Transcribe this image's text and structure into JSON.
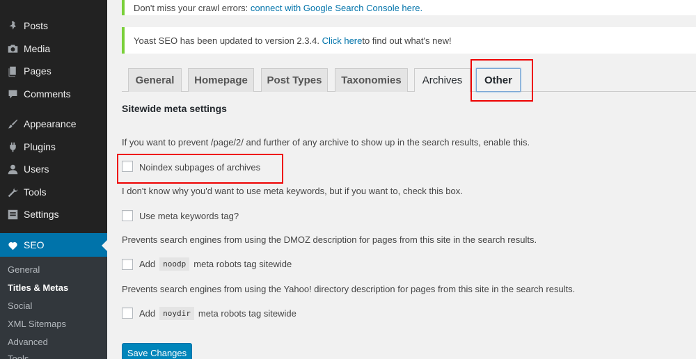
{
  "sidebar": {
    "items": [
      {
        "label": "Posts",
        "icon": "pushpin-icon"
      },
      {
        "label": "Media",
        "icon": "media-icon"
      },
      {
        "label": "Pages",
        "icon": "pages-icon"
      },
      {
        "label": "Comments",
        "icon": "comments-icon"
      },
      {
        "label": "Appearance",
        "icon": "brush-icon"
      },
      {
        "label": "Plugins",
        "icon": "plugin-icon"
      },
      {
        "label": "Users",
        "icon": "users-icon"
      },
      {
        "label": "Tools",
        "icon": "wrench-icon"
      },
      {
        "label": "Settings",
        "icon": "settings-icon"
      }
    ],
    "seo_label": "SEO",
    "submenu": [
      "General",
      "Titles & Metas",
      "Social",
      "XML Sitemaps",
      "Advanced",
      "Tools"
    ]
  },
  "notices": {
    "crawl_text": "Don't miss your crawl errors: ",
    "crawl_link": "connect with Google Search Console here.",
    "update_text": "Yoast SEO has been updated to version 2.3.4. ",
    "update_link": "Click here",
    "update_tail": " to find out what's new!"
  },
  "tabs": [
    "General",
    "Homepage",
    "Post Types",
    "Taxonomies",
    "Archives",
    "Other"
  ],
  "section_title": "Sitewide meta settings",
  "options": {
    "desc1": "If you want to prevent /page/2/ and further of any archive to show up in the search results, enable this.",
    "label1": "Noindex subpages of archives",
    "desc2": "I don't know why you'd want to use meta keywords, but if you want to, check this box.",
    "label2": "Use meta keywords tag?",
    "desc3": "Prevents search engines from using the DMOZ description for pages from this site in the search results.",
    "label3_pre": "Add",
    "label3_code": "noodp",
    "label3_post": "meta robots tag sitewide",
    "desc4": "Prevents search engines from using the Yahoo! directory description for pages from this site in the search results.",
    "label4_pre": "Add",
    "label4_code": "noydir",
    "label4_post": "meta robots tag sitewide"
  },
  "save_label": "Save Changes",
  "colors": {
    "accent": "#0073aa",
    "notice_border": "#7ad03a",
    "highlight": "#e00000"
  }
}
